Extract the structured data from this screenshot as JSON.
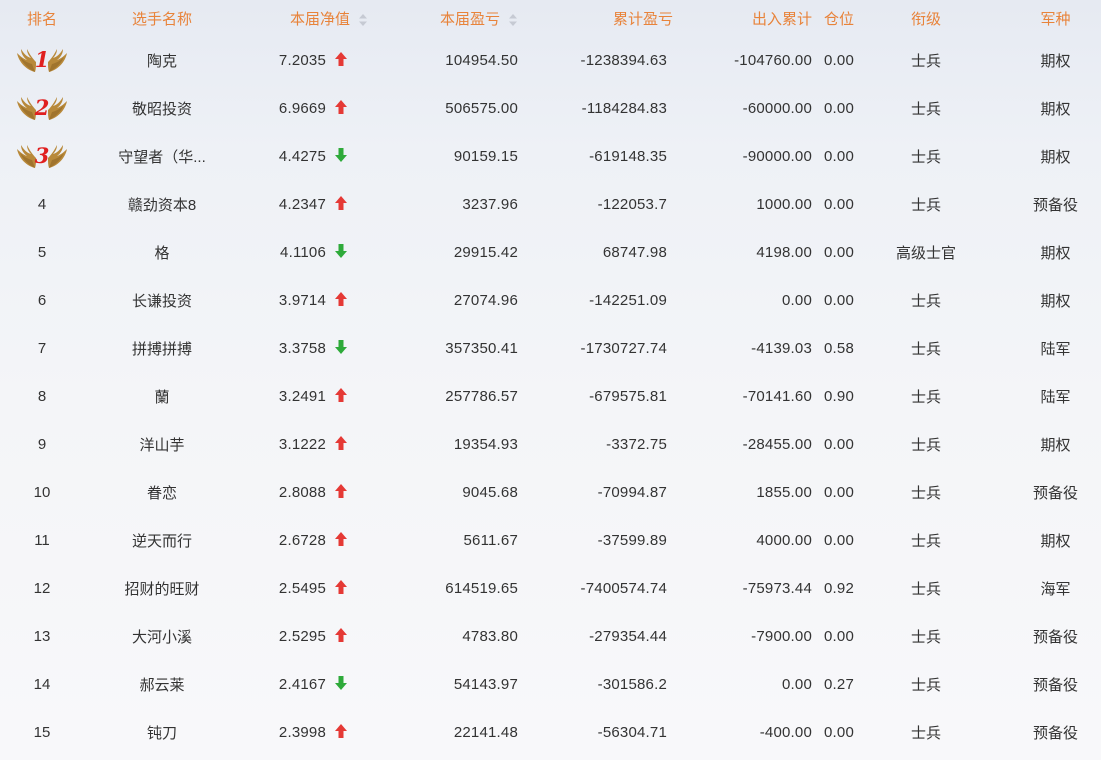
{
  "headers": {
    "rank": "排名",
    "name": "选手名称",
    "nav": "本届净值",
    "pnl": "本届盈亏",
    "cum_pnl": "累计盈亏",
    "cum_flow": "出入累计",
    "position": "仓位",
    "title": "衔级",
    "branch": "军种"
  },
  "colors": {
    "up_arrow": "#e53935",
    "down_arrow": "#2eaa3a",
    "header": "#e8833a",
    "medal_gold": "#b8893a",
    "medal_number": "#e02020"
  },
  "rows": [
    {
      "rank": "1",
      "medal": true,
      "name": "陶克",
      "nav": "7.2035",
      "trend": "up",
      "pnl": "104954.50",
      "cum_pnl": "-1238394.63",
      "cum_flow": "-104760.00",
      "position": "0.00",
      "title": "士兵",
      "branch": "期权"
    },
    {
      "rank": "2",
      "medal": true,
      "name": "敬昭投资",
      "nav": "6.9669",
      "trend": "up",
      "pnl": "506575.00",
      "cum_pnl": "-1184284.83",
      "cum_flow": "-60000.00",
      "position": "0.00",
      "title": "士兵",
      "branch": "期权"
    },
    {
      "rank": "3",
      "medal": true,
      "name": "守望者（华...",
      "nav": "4.4275",
      "trend": "down",
      "pnl": "90159.15",
      "cum_pnl": "-619148.35",
      "cum_flow": "-90000.00",
      "position": "0.00",
      "title": "士兵",
      "branch": "期权"
    },
    {
      "rank": "4",
      "medal": false,
      "name": "赣劲资本8",
      "nav": "4.2347",
      "trend": "up",
      "pnl": "3237.96",
      "cum_pnl": "-122053.7",
      "cum_flow": "1000.00",
      "position": "0.00",
      "title": "士兵",
      "branch": "预备役"
    },
    {
      "rank": "5",
      "medal": false,
      "name": "格",
      "nav": "4.1106",
      "trend": "down",
      "pnl": "29915.42",
      "cum_pnl": "68747.98",
      "cum_flow": "4198.00",
      "position": "0.00",
      "title": "高级士官",
      "branch": "期权"
    },
    {
      "rank": "6",
      "medal": false,
      "name": "长谦投资",
      "nav": "3.9714",
      "trend": "up",
      "pnl": "27074.96",
      "cum_pnl": "-142251.09",
      "cum_flow": "0.00",
      "position": "0.00",
      "title": "士兵",
      "branch": "期权"
    },
    {
      "rank": "7",
      "medal": false,
      "name": "拼搏拼搏",
      "nav": "3.3758",
      "trend": "down",
      "pnl": "357350.41",
      "cum_pnl": "-1730727.74",
      "cum_flow": "-4139.03",
      "position": "0.58",
      "title": "士兵",
      "branch": "陆军"
    },
    {
      "rank": "8",
      "medal": false,
      "name": "蘭",
      "nav": "3.2491",
      "trend": "up",
      "pnl": "257786.57",
      "cum_pnl": "-679575.81",
      "cum_flow": "-70141.60",
      "position": "0.90",
      "title": "士兵",
      "branch": "陆军"
    },
    {
      "rank": "9",
      "medal": false,
      "name": "洋山芋",
      "nav": "3.1222",
      "trend": "up",
      "pnl": "19354.93",
      "cum_pnl": "-3372.75",
      "cum_flow": "-28455.00",
      "position": "0.00",
      "title": "士兵",
      "branch": "期权"
    },
    {
      "rank": "10",
      "medal": false,
      "name": "眷恋",
      "nav": "2.8088",
      "trend": "up",
      "pnl": "9045.68",
      "cum_pnl": "-70994.87",
      "cum_flow": "1855.00",
      "position": "0.00",
      "title": "士兵",
      "branch": "预备役"
    },
    {
      "rank": "11",
      "medal": false,
      "name": "逆天而行",
      "nav": "2.6728",
      "trend": "up",
      "pnl": "5611.67",
      "cum_pnl": "-37599.89",
      "cum_flow": "4000.00",
      "position": "0.00",
      "title": "士兵",
      "branch": "期权"
    },
    {
      "rank": "12",
      "medal": false,
      "name": "招财的旺财",
      "nav": "2.5495",
      "trend": "up",
      "pnl": "614519.65",
      "cum_pnl": "-7400574.74",
      "cum_flow": "-75973.44",
      "position": "0.92",
      "title": "士兵",
      "branch": "海军"
    },
    {
      "rank": "13",
      "medal": false,
      "name": "大河小溪",
      "nav": "2.5295",
      "trend": "up",
      "pnl": "4783.80",
      "cum_pnl": "-279354.44",
      "cum_flow": "-7900.00",
      "position": "0.00",
      "title": "士兵",
      "branch": "预备役"
    },
    {
      "rank": "14",
      "medal": false,
      "name": "郝云莱",
      "nav": "2.4167",
      "trend": "down",
      "pnl": "54143.97",
      "cum_pnl": "-301586.2",
      "cum_flow": "0.00",
      "position": "0.27",
      "title": "士兵",
      "branch": "预备役"
    },
    {
      "rank": "15",
      "medal": false,
      "name": "钝刀",
      "nav": "2.3998",
      "trend": "up",
      "pnl": "22141.48",
      "cum_pnl": "-56304.71",
      "cum_flow": "-400.00",
      "position": "0.00",
      "title": "士兵",
      "branch": "预备役"
    }
  ]
}
